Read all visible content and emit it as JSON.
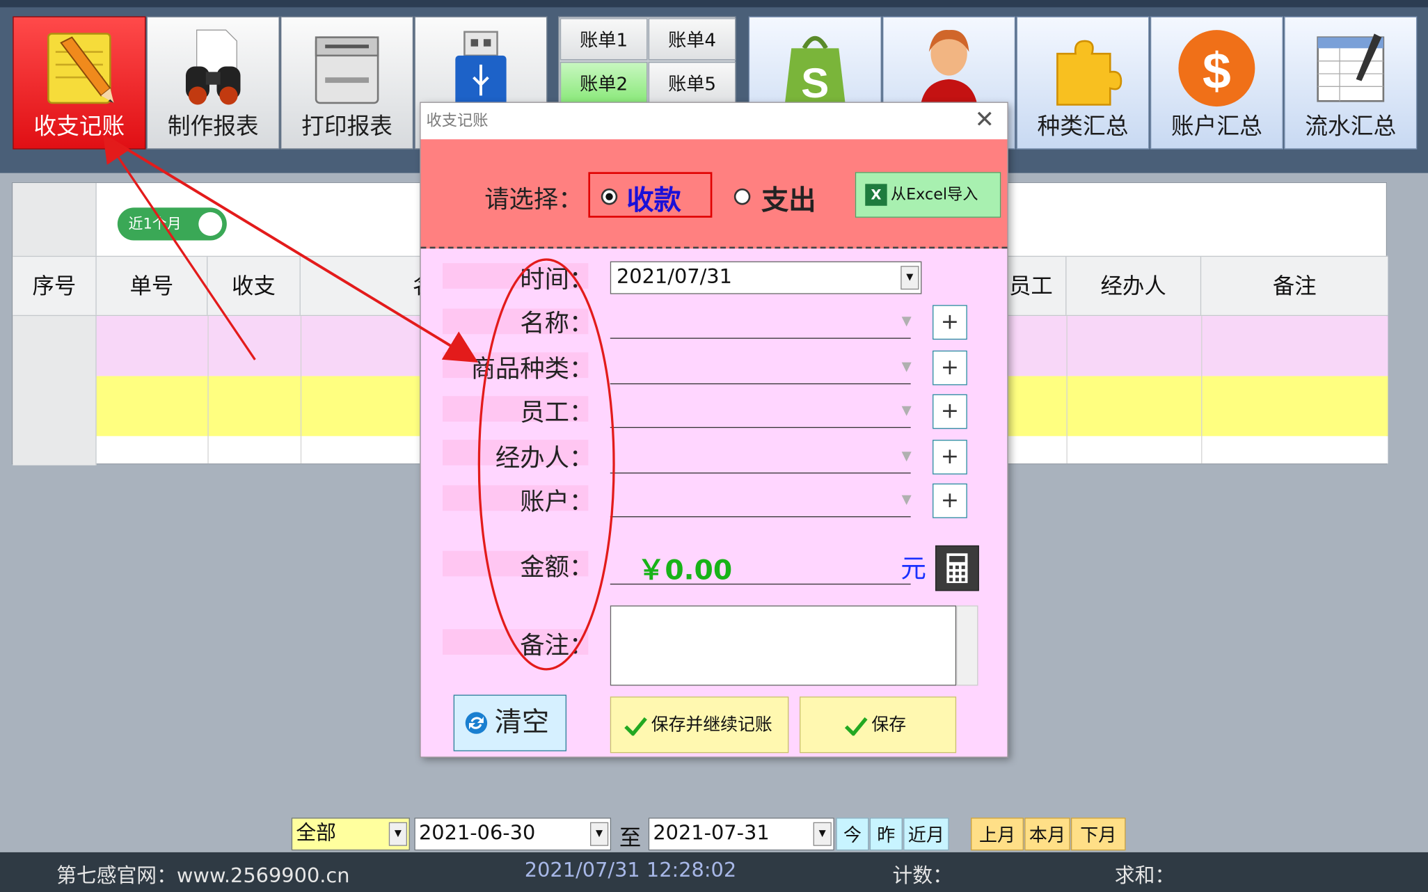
{
  "toolbar": {
    "ledger": "收支记账",
    "make_report": "制作报表",
    "print_report": "打印报表",
    "category_summary": "种类汇总",
    "account_summary": "账户汇总",
    "flow_summary": "流水汇总"
  },
  "bills": [
    "账单1",
    "账单4",
    "账单2",
    "账单5"
  ],
  "grid": {
    "toggle": "近1个月",
    "headers": {
      "seq": "序号",
      "no": "单号",
      "inout": "收支",
      "name": "名称",
      "staff_partial": "员工",
      "handler": "经办人",
      "memo": "备注"
    }
  },
  "dialog": {
    "title": "收支记账",
    "select_label": "请选择：",
    "receipt": "收款",
    "expense": "支出",
    "excel_import": "从Excel导入",
    "time_label": "时间：",
    "time_value": "2021/07/31",
    "name_label": "名称：",
    "category_label": "商品种类：",
    "staff_label": "员工：",
    "handler_label": "经办人：",
    "account_label": "账户：",
    "amount_label": "金额：",
    "amount_value": "￥0.00",
    "yuan": "元",
    "memo_label": "备注：",
    "clear": "清空",
    "save_continue": "保存并继续记账",
    "save": "保存",
    "plus": "+"
  },
  "filter": {
    "type": "全部",
    "from": "2021-06-30",
    "to_label": "至",
    "to": "2021-07-31",
    "today": "今",
    "yesterday": "昨",
    "recent_month": "近月",
    "last_month": "上月",
    "this_month": "本月",
    "next_month": "下月"
  },
  "status": {
    "site": "第七感官网：www.2569900.cn",
    "datetime": "2021/07/31 12:28:02",
    "count_label": "计数：",
    "sum_label": "求和："
  },
  "colors": {
    "active_tool": "#e00f14",
    "dialog_header": "#ff8080",
    "dialog_body": "#ffd6ff",
    "amount": "#18b318",
    "annotation": "#e31b1b"
  }
}
